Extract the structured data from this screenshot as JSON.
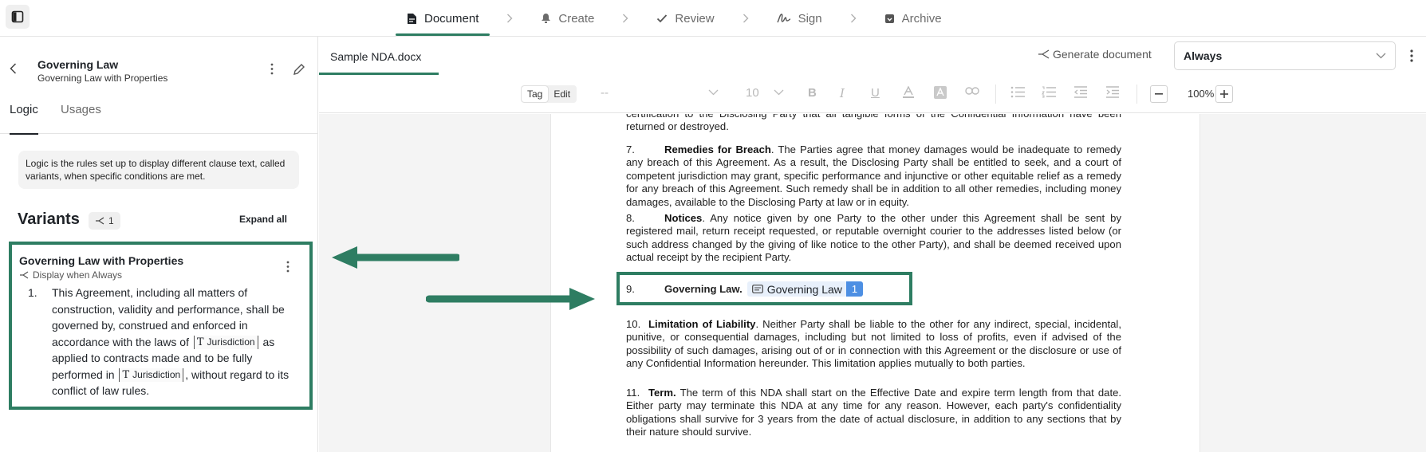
{
  "topbar": {
    "steps": [
      {
        "label": "Document",
        "icon": "document-icon",
        "active": true
      },
      {
        "label": "Create",
        "icon": "bell-icon",
        "active": false
      },
      {
        "label": "Review",
        "icon": "check-icon",
        "active": false
      },
      {
        "label": "Sign",
        "icon": "signature-icon",
        "active": false
      },
      {
        "label": "Archive",
        "icon": "archive-icon",
        "active": false
      }
    ]
  },
  "left_panel": {
    "title": "Governing Law",
    "subtitle": "Governing Law with Properties",
    "tabs": [
      {
        "label": "Logic",
        "active": true
      },
      {
        "label": "Usages",
        "active": false
      }
    ],
    "info": "Logic is the rules set up to display different clause text, called variants, when specific conditions are met.",
    "variants_heading": "Variants",
    "variant_count": "1",
    "expand_all": "Expand all",
    "variant": {
      "title": "Governing Law with Properties",
      "condition": "Display when Always",
      "number": "1.",
      "text_1": "This Agreement, including all matters of construction, validity and performance, shall be governed by, construed and enforced in accordance with the laws of",
      "token_1": "Jurisdiction",
      "text_2": "as applied to contracts made and to be fully performed in",
      "token_2": "Jurisdiction",
      "text_3": ", without regard to its conflict of law rules."
    }
  },
  "document": {
    "filename": "Sample NDA.docx",
    "generate_label": "Generate document",
    "condition_select": "Always",
    "toolbar": {
      "tag_label": "Tag",
      "edit_label": "Edit",
      "font_placeholder": "--",
      "font_size": "10",
      "zoom": "100%"
    },
    "paragraphs": {
      "p6_tail": "certification to the Disclosing Party that all tangible forms of the Confidential Information have been returned or destroyed.",
      "p7_num": "7.",
      "p7_heading": "Remedies for Breach",
      "p7_text": ". The Parties agree that money damages would be inadequate to remedy any breach of this Agreement. As a result, the Disclosing Party shall be entitled to seek, and a court of competent jurisdiction may grant, specific performance and injunctive or other equitable relief as a remedy for any breach of this Agreement. Such remedy shall be in addition to all other remedies, including money damages, available to the Disclosing Party at law or in equity.",
      "p8_num": "8.",
      "p8_heading": "Notices",
      "p8_text": ". Any notice given by one Party to the other under this Agreement shall be sent by registered mail, return receipt requested, or reputable overnight courier to the addresses listed below (or such address changed by the giving of like notice to the other Party), and shall be deemed received upon actual receipt by the recipient Party.",
      "p9_num": "9.",
      "p9_heading": "Governing Law.",
      "p9_chip": "Governing Law",
      "p9_badge": "1",
      "p10_num": "10.",
      "p10_heading": "Limitation of Liability",
      "p10_text": ". Neither Party shall be liable to the other for any indirect, special, incidental, punitive, or consequential damages, including but not limited to loss of profits, even if advised of the possibility of such damages, arising out of or in connection with this Agreement or the disclosure or use of any Confidential Information hereunder. This limitation applies mutually to both parties.",
      "p11_num": "11.",
      "p11_heading": "Term.",
      "p11_text": " The term of this NDA shall start on the Effective Date and expire term length from that date. Either party may terminate this NDA at any time for any reason. However, each party's confidentiality obligations shall survive for 3 years from the date of actual disclosure, in addition to any sections that by their nature should survive."
    }
  },
  "colors": {
    "accent": "#2e7d62",
    "chip_bg": "#e8f0fb",
    "badge": "#4d8fe3"
  }
}
